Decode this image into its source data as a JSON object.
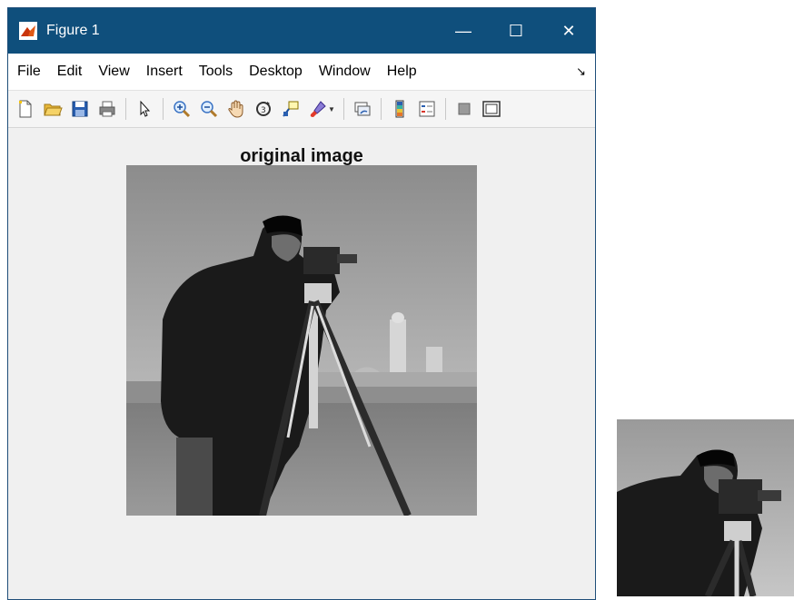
{
  "window": {
    "title": "Figure 1"
  },
  "title_controls": {
    "minimize": "—",
    "maximize": "☐",
    "close": "✕"
  },
  "menu": [
    "File",
    "Edit",
    "View",
    "Insert",
    "Tools",
    "Desktop",
    "Window",
    "Help"
  ],
  "menu_arrow": "↘",
  "toolbar": {
    "icons": [
      "new-figure-icon",
      "open-file-icon",
      "save-icon",
      "print-icon",
      "pointer-icon",
      "zoom-in-icon",
      "zoom-out-icon",
      "pan-hand-icon",
      "rotate-3d-icon",
      "data-cursor-icon",
      "brush-icon",
      "link-plot-icon",
      "colorbar-icon",
      "legend-icon",
      "hide-plot-tools-icon",
      "show-plot-tools-icon"
    ],
    "dropdown_glyph": "▼"
  },
  "axes": {
    "title": "original image"
  },
  "colors": {
    "titlebar": "#0f4f7c",
    "background": "#f0f0f0"
  }
}
